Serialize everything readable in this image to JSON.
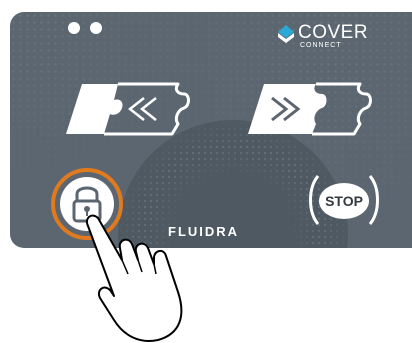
{
  "indicators": [
    {
      "name": "led-1"
    },
    {
      "name": "led-2"
    }
  ],
  "brand": {
    "name": "COVER",
    "sub": "CONNECT",
    "icon": "cover-shield-icon"
  },
  "controls": {
    "open_cover": {
      "icon": "chevron-left-double-icon"
    },
    "close_cover": {
      "icon": "chevron-right-double-icon"
    },
    "lock": {
      "icon": "padlock-icon",
      "ring_color": "#e07a1f"
    },
    "stop": {
      "label": "STOP"
    }
  },
  "footer": {
    "logo": "FLUIDRA"
  },
  "colors": {
    "panel": "#5b6670",
    "accent": "#e07a1f",
    "icon": "#ffffff"
  }
}
